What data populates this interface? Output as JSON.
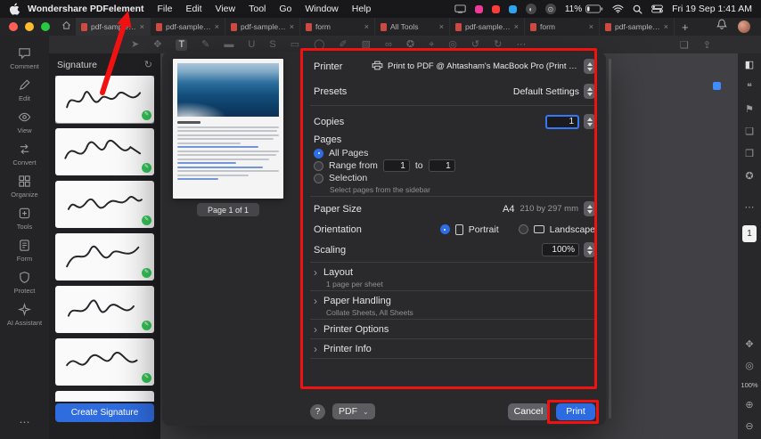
{
  "menubar": {
    "app_name": "Wondershare PDFelement",
    "menus": [
      "File",
      "Edit",
      "View",
      "Tool",
      "Go",
      "Window",
      "Help"
    ],
    "circle_icons": [
      "◐",
      "⊙"
    ],
    "battery_percent": "11%",
    "clock": "Fri 19 Sep  1:41 AM"
  },
  "tabbar": {
    "close_glyph": "×",
    "new_tab_glyph": "+",
    "tabs": [
      {
        "label": "pdf-sample-..."
      },
      {
        "label": "pdf-sample-ma..."
      },
      {
        "label": "pdf-sample-ma..."
      },
      {
        "label": "form"
      },
      {
        "label": "All Tools"
      },
      {
        "label": "pdf-sample-ma..."
      },
      {
        "label": "form"
      },
      {
        "label": "pdf-sample-..."
      }
    ]
  },
  "toolbar": {
    "icons": [
      {
        "name": "select-tool-icon",
        "glyph": "➤"
      },
      {
        "name": "hand-tool-icon",
        "glyph": "✥"
      },
      {
        "name": "text-tool-icon",
        "glyph": "T"
      },
      {
        "name": "signature-tool-icon",
        "glyph": "✎"
      },
      {
        "name": "highlight-tool-icon",
        "glyph": "▬"
      },
      {
        "name": "underline-tool-icon",
        "glyph": "U"
      },
      {
        "name": "strikethrough-tool-icon",
        "glyph": "S"
      },
      {
        "name": "shape-rect-tool-icon",
        "glyph": "▭"
      },
      {
        "name": "shape-ellipse-tool-icon",
        "glyph": "◯"
      },
      {
        "name": "pencil-tool-icon",
        "glyph": "✐"
      },
      {
        "name": "image-tool-icon",
        "glyph": "▨"
      },
      {
        "name": "link-tool-icon",
        "glyph": "∞"
      },
      {
        "name": "stamp-tool-icon",
        "glyph": "✪"
      },
      {
        "name": "measure-tool-icon",
        "glyph": "⌖"
      },
      {
        "name": "search-tool-icon",
        "glyph": "◎"
      },
      {
        "name": "undo-icon",
        "glyph": "↺"
      },
      {
        "name": "redo-icon",
        "glyph": "↻"
      },
      {
        "name": "more-tools-icon",
        "glyph": "⋯"
      }
    ],
    "print_icon_glyph": "❑",
    "share_icon_glyph": "⇪"
  },
  "sidebar": {
    "items": [
      "Comment",
      "Edit",
      "View",
      "Convert",
      "Organize",
      "Tools",
      "Form",
      "Protect",
      "AI Assistant"
    ],
    "more_glyph": "⋯"
  },
  "signature_panel": {
    "title": "Signature",
    "refresh_glyph": "↻",
    "badge_glyph": "✎",
    "create_button_label": "Create Signature"
  },
  "print_dialog": {
    "page_indicator": "Page 1 of 1",
    "section_chevron": "›",
    "printer": {
      "label": "Printer",
      "value": "Print to PDF @ Ahtasham's MacBook Pro (Print to PDF @ Ahtasham's Mac..."
    },
    "presets": {
      "label": "Presets",
      "value": "Default Settings"
    },
    "copies": {
      "label": "Copies",
      "value": "1"
    },
    "pages": {
      "label": "Pages",
      "all_pages_label": "All Pages",
      "range_from_label": "Range from",
      "range_from_value": "1",
      "to_label": "to",
      "range_to_value": "1",
      "selection_label": "Selection",
      "selection_hint": "Select pages from the sidebar"
    },
    "paper_size": {
      "label": "Paper Size",
      "value": "A4",
      "dimensions": "210 by 297 mm"
    },
    "orientation": {
      "label": "Orientation",
      "portrait_label": "Portrait",
      "landscape_label": "Landscape"
    },
    "scaling": {
      "label": "Scaling",
      "value": "100%"
    },
    "sections": [
      {
        "title": "Layout",
        "subtitle": "1 page per sheet"
      },
      {
        "title": "Paper Handling",
        "subtitle": "Collate Sheets, All Sheets"
      },
      {
        "title": "Printer Options",
        "subtitle": ""
      },
      {
        "title": "Printer Info",
        "subtitle": ""
      }
    ],
    "footer": {
      "help_label": "?",
      "pdf_menu_label": "PDF",
      "pdf_chevron": "⌄",
      "cancel_label": "Cancel",
      "print_label": "Print"
    }
  },
  "right_sidebar": {
    "top_icons": [
      {
        "name": "panel-toggle-icon",
        "glyph": "◧"
      },
      {
        "name": "comment-list-icon",
        "glyph": "❝"
      },
      {
        "name": "bookmark-panel-icon",
        "glyph": "⚑"
      },
      {
        "name": "thumbnail-panel-icon",
        "glyph": "❏"
      },
      {
        "name": "attachment-panel-icon",
        "glyph": "❒"
      },
      {
        "name": "stamp-panel-icon",
        "glyph": "✪"
      }
    ],
    "more_glyph": "⋯",
    "page_number": "1",
    "pan_glyph": "✥",
    "snapshot_glyph": "◎",
    "zoom_level": "100%",
    "zoom_in_glyph": "⊕",
    "zoom_out_glyph": "⊖"
  },
  "colors": {
    "accent": "#2e6de4",
    "annotation_red": "#f21111",
    "print_button": "#2c6be1",
    "badge_green": "#34c759"
  }
}
